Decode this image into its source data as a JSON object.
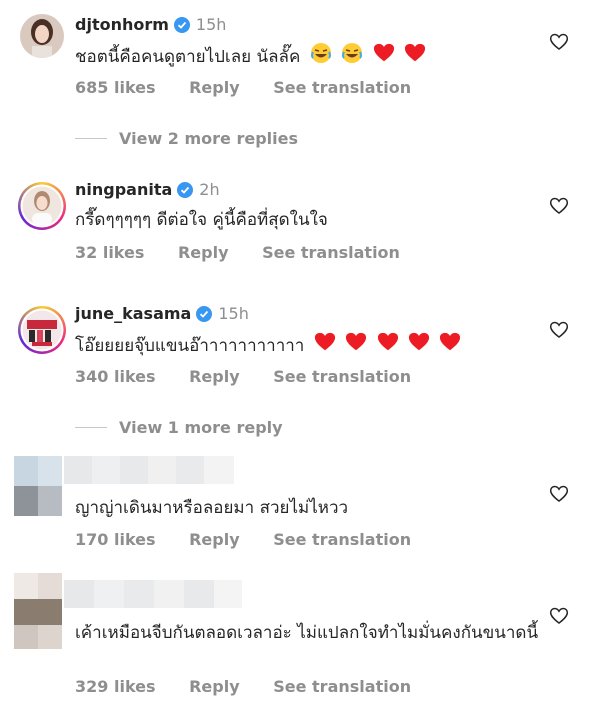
{
  "comments": [
    {
      "username": "djtonhorm",
      "verified": true,
      "time": "15h",
      "text": "ชอตนี้คือคนดูตายไปเลย นัลลั๊ค",
      "emojis": [
        "laughing-emoji",
        "laughing-emoji",
        "red-heart-emoji",
        "red-heart-emoji"
      ],
      "likes": "685 likes",
      "reply": "Reply",
      "translate": "See translation"
    },
    {
      "username": "ningpanita",
      "verified": true,
      "time": "2h",
      "text": "กรี๊ดๆๆๆๆๆ ดีต่อใจ คู่นี้คือที่สุดในใจ",
      "likes": "32 likes",
      "reply": "Reply",
      "translate": "See translation"
    },
    {
      "username": "june_kasama",
      "verified": true,
      "time": "15h",
      "text": "โอ๊ยยยยจุ๊บแขนอ๊าาาาาาาาาาา",
      "emojis": [
        "red-heart-emoji",
        "red-heart-emoji",
        "red-heart-emoji",
        "red-heart-emoji",
        "red-heart-emoji"
      ],
      "likes": "340 likes",
      "reply": "Reply",
      "translate": "See translation"
    },
    {
      "text": "ญาญ่าเดินมาหรือลอยมา สวยไม่ไหวว",
      "likes": "170 likes",
      "reply": "Reply",
      "translate": "See translation"
    },
    {
      "text": "เค้าเหมือนจีบกันตลอดเวลาอ่ะ ไม่แปลกใจทำไมมั่นคงกันขนาดนี้",
      "likes": "329 likes",
      "reply": "Reply",
      "translate": "See translation"
    }
  ],
  "view_more_replies_1": "View 2 more replies",
  "view_more_replies_2": "View 1 more reply",
  "colors": {
    "text": "#262626",
    "muted": "#8e8e8e",
    "verified_blue": "#3897f0",
    "heart_red": "#ed1c24"
  }
}
